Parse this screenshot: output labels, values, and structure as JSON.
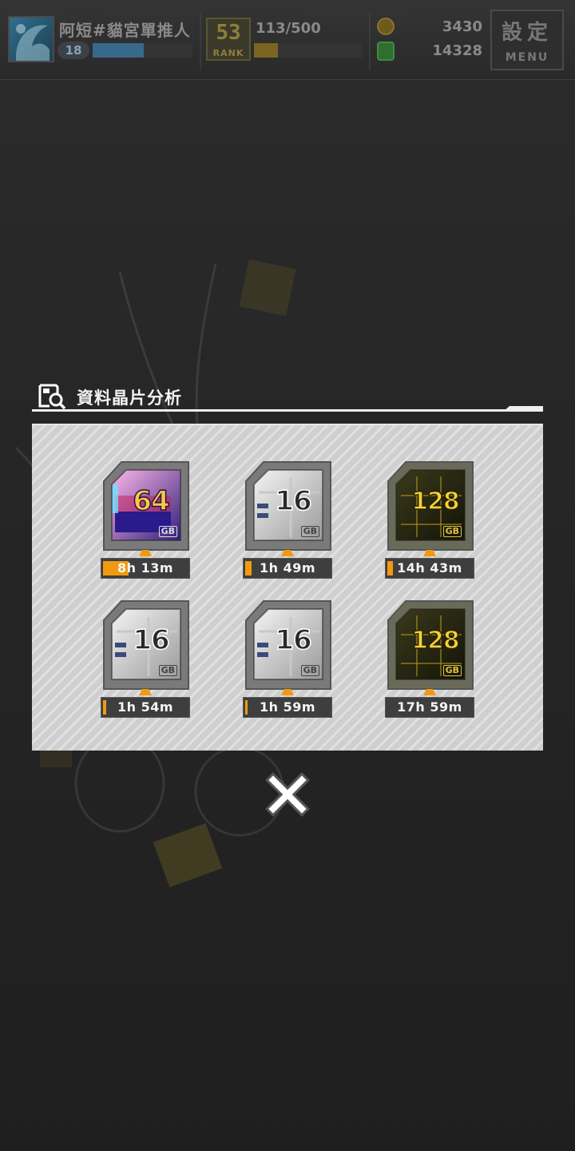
{
  "header": {
    "player_name": "阿短#貓宮單推人",
    "level": "18",
    "level_progress": 0.52,
    "rank": "53",
    "rank_label": "RANK",
    "stamina": "113/500",
    "stamina_progress": 0.22,
    "coins": "3430",
    "gems": "14328",
    "menu_top": "設定",
    "menu_bottom": "MENU"
  },
  "dialog": {
    "title": "資料晶片分析",
    "chips": [
      {
        "capacity": "64",
        "unit": "GB",
        "style": "rainbow",
        "timer": "8h 13m",
        "progress": 0.3
      },
      {
        "capacity": "16",
        "unit": "GB",
        "style": "silver",
        "timer": "1h 49m",
        "progress": 0.08
      },
      {
        "capacity": "128",
        "unit": "GB",
        "style": "gold",
        "timer": "14h 43m",
        "progress": 0.07
      },
      {
        "capacity": "16",
        "unit": "GB",
        "style": "silver",
        "timer": "1h 54m",
        "progress": 0.04
      },
      {
        "capacity": "16",
        "unit": "GB",
        "style": "silver",
        "timer": "1h 59m",
        "progress": 0.01
      },
      {
        "capacity": "128",
        "unit": "GB",
        "style": "gold",
        "timer": "17h 59m",
        "progress": 0.0
      }
    ]
  },
  "colors": {
    "accent_orange": "#f19a10",
    "panel": "#cfcfcf",
    "backdrop": "#232323"
  },
  "icons": {
    "dialog_icon": "chip-search-icon",
    "close": "close-icon"
  }
}
